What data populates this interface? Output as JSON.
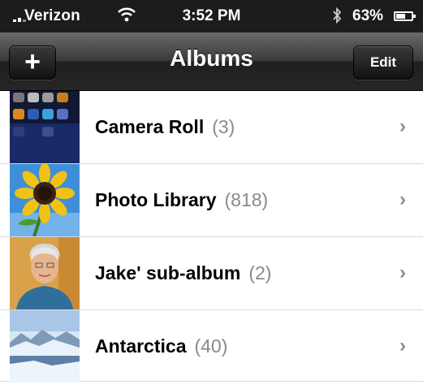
{
  "status_bar": {
    "carrier": "Verizon",
    "time": "3:52 PM",
    "battery": "63%",
    "battery_level": 0.63,
    "icons": [
      "signal-icon",
      "wifi-icon",
      "bluetooth-icon",
      "battery-icon"
    ]
  },
  "nav": {
    "add_label": "+",
    "title": "Albums",
    "edit_label": "Edit"
  },
  "albums": [
    {
      "name": "Camera Roll",
      "count": "(3)",
      "thumb": "camera-roll-thumbnail"
    },
    {
      "name": "Photo Library",
      "count": "(818)",
      "thumb": "sunflower-thumbnail"
    },
    {
      "name": "Jake' sub-album",
      "count": "(2)",
      "thumb": "portrait-thumbnail"
    },
    {
      "name": "Antarctica",
      "count": "(40)",
      "thumb": "glacier-thumbnail"
    }
  ],
  "colors": {
    "nav_bar": "#3b3b3b",
    "status_bar": "#1c1c1c",
    "count_text": "#8a8a8a",
    "chevron": "#8c8c8c"
  }
}
